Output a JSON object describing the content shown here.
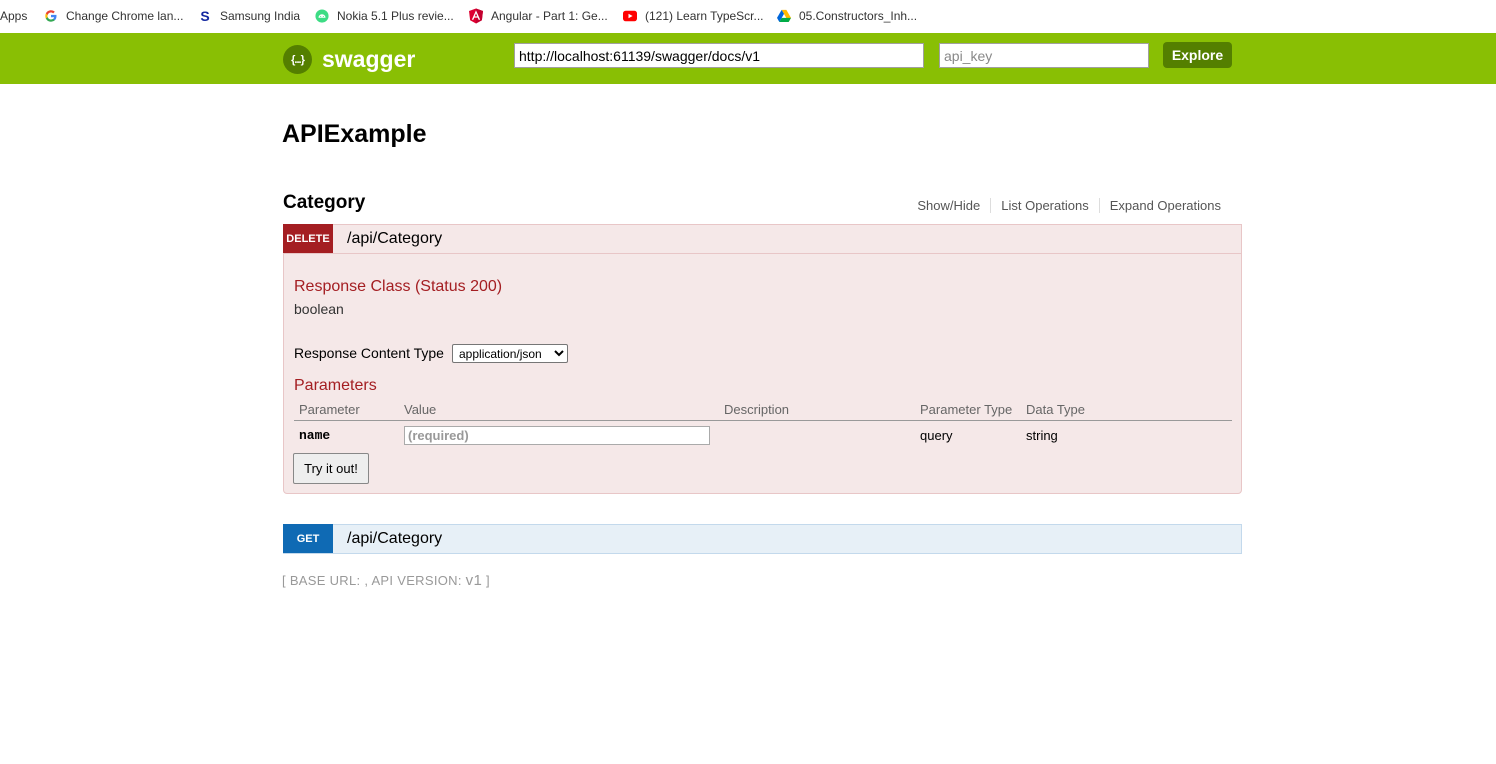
{
  "bookmarks": [
    {
      "label": "Apps",
      "icon": "apps-grid-icon"
    },
    {
      "label": "Change Chrome lan...",
      "icon": "google-icon"
    },
    {
      "label": "Samsung India",
      "icon": "samsung-icon"
    },
    {
      "label": "Nokia 5.1 Plus revie...",
      "icon": "android-icon"
    },
    {
      "label": "Angular - Part 1: Ge...",
      "icon": "angular-icon"
    },
    {
      "label": "(121) Learn TypeScr...",
      "icon": "youtube-icon"
    },
    {
      "label": "05.Constructors_Inh...",
      "icon": "google-drive-icon"
    }
  ],
  "header": {
    "logo_text": "swagger",
    "logo_glyph": "{...}",
    "url_value": "http://localhost:61139/swagger/docs/v1",
    "api_key_placeholder": "api_key",
    "explore_label": "Explore",
    "colors": {
      "bar": "#89bf04",
      "button": "#547f00"
    }
  },
  "api": {
    "title": "APIExample"
  },
  "resource": {
    "name": "Category",
    "links": [
      "Show/Hide",
      "List Operations",
      "Expand Operations"
    ]
  },
  "operations": {
    "delete": {
      "method": "DELETE",
      "path": "/api/Category",
      "response_class_title": "Response Class (Status 200)",
      "response_type": "boolean",
      "content_type_label": "Response Content Type",
      "content_type_selected": "application/json",
      "parameters_title": "Parameters",
      "columns": [
        "Parameter",
        "Value",
        "Description",
        "Parameter Type",
        "Data Type"
      ],
      "params": [
        {
          "name": "name",
          "value_placeholder": "(required)",
          "description": "",
          "param_type": "query",
          "data_type": "string"
        }
      ],
      "try_label": "Try it out!",
      "color": "#a41e22"
    },
    "get": {
      "method": "GET",
      "path": "/api/Category",
      "color": "#0f6ab4"
    }
  },
  "footer": {
    "base_url_text": "[ BASE URL: , API VERSION: ",
    "version": "v1",
    "close": " ]"
  }
}
